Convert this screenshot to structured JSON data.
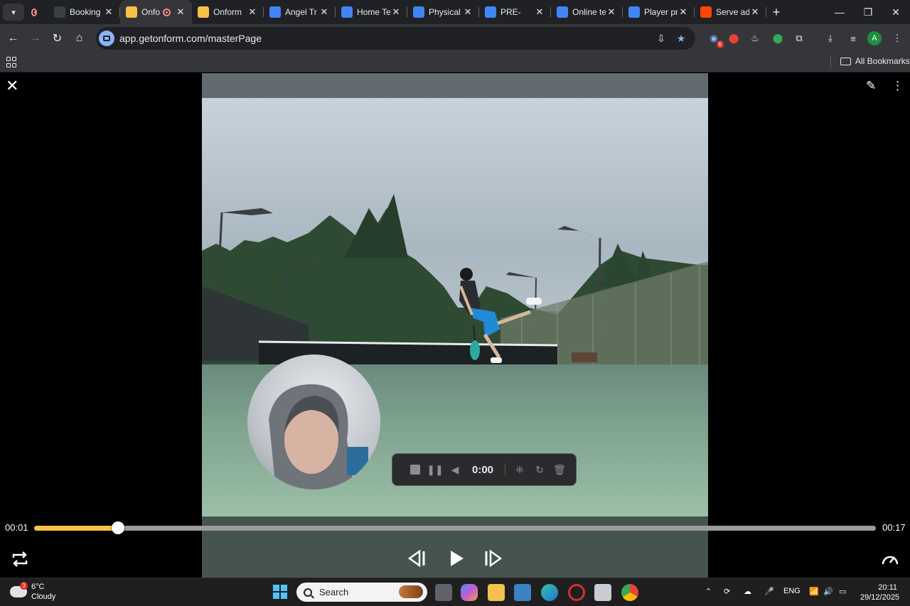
{
  "browser": {
    "tabs": [
      {
        "label": "Booking",
        "favicon": "cal-icon",
        "color": "#3c4043"
      },
      {
        "label": "Onfo",
        "favicon": "onform-icon",
        "color": "#f6c245",
        "active": true,
        "recording": true
      },
      {
        "label": "Onform",
        "favicon": "onform-icon",
        "color": "#f6c245"
      },
      {
        "label": "Angel Tr",
        "favicon": "docs-icon",
        "color": "#4285f4"
      },
      {
        "label": "Home Te",
        "favicon": "docs-icon",
        "color": "#4285f4"
      },
      {
        "label": "Physical",
        "favicon": "docs-icon",
        "color": "#4285f4"
      },
      {
        "label": "PRE-",
        "favicon": "docs-icon",
        "color": "#4285f4"
      },
      {
        "label": "Online te",
        "favicon": "docs-icon",
        "color": "#4285f4"
      },
      {
        "label": "Player pr",
        "favicon": "docs-icon",
        "color": "#4285f4"
      },
      {
        "label": "Serve ad",
        "favicon": "reddit-icon",
        "color": "#ff4500"
      }
    ],
    "url": "app.getonform.com/masterPage",
    "bookmarks_label": "All Bookmarks",
    "extension_badge": "6"
  },
  "player": {
    "current_time": "00:01",
    "total_time": "00:17",
    "progress": 0.1,
    "recorder": {
      "time": "0:00"
    },
    "accent_color": "#f6c245"
  },
  "taskbar": {
    "weather": {
      "temp": "6°C",
      "condition": "Cloudy",
      "badge": "3"
    },
    "search_placeholder": "Search",
    "language": "ENG",
    "time": "20:11",
    "date": "29/12/2025"
  }
}
